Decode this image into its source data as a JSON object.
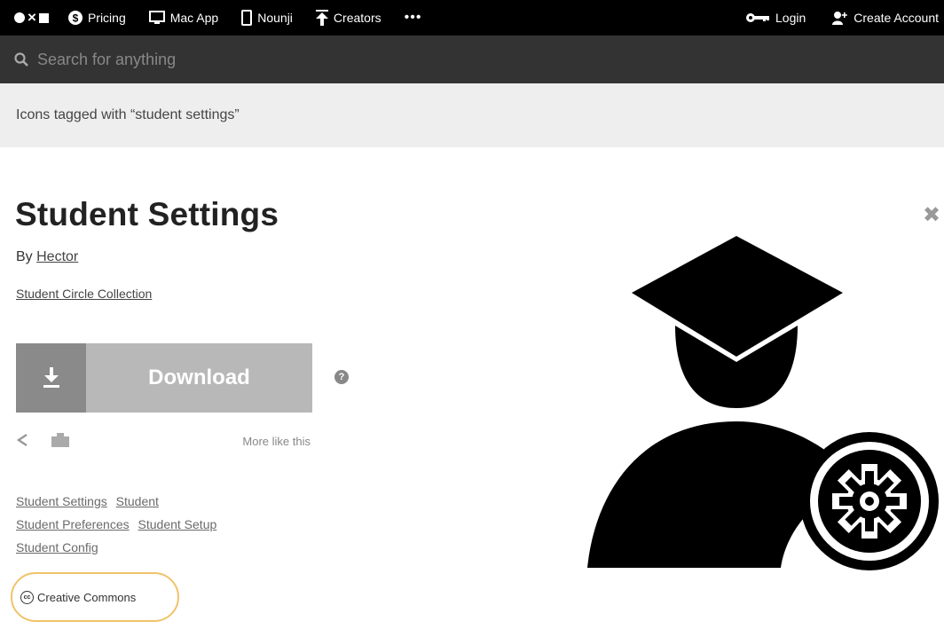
{
  "nav": {
    "items": [
      {
        "label": "Pricing",
        "icon": "dollar-icon"
      },
      {
        "label": "Mac App",
        "icon": "monitor-icon"
      },
      {
        "label": "Nounji",
        "icon": "phone-icon"
      },
      {
        "label": "Creators",
        "icon": "upload-icon"
      }
    ],
    "more": "•••",
    "login": "Login",
    "create_account": "Create Account"
  },
  "search": {
    "placeholder": "Search for anything"
  },
  "tagbar": {
    "text": "Icons tagged with “student settings”"
  },
  "icon": {
    "title": "Student Settings",
    "by_prefix": "By",
    "author": "Hector",
    "collection": "Student Circle Collection",
    "download_label": "Download",
    "help": "?",
    "more_like_this": "More like this",
    "tags": [
      "Student Settings",
      "Student",
      "Student Preferences",
      "Student Setup",
      "Student Config"
    ],
    "license": "Creative Commons",
    "license_badge": "cc"
  },
  "colors": {
    "nav_bg": "#000000",
    "search_bg": "#333333",
    "tagbar_bg": "#eeeeee",
    "download_icon_bg": "#8a8a8a",
    "download_bg": "#b8b8b8",
    "license_highlight": "#f0c36a"
  }
}
